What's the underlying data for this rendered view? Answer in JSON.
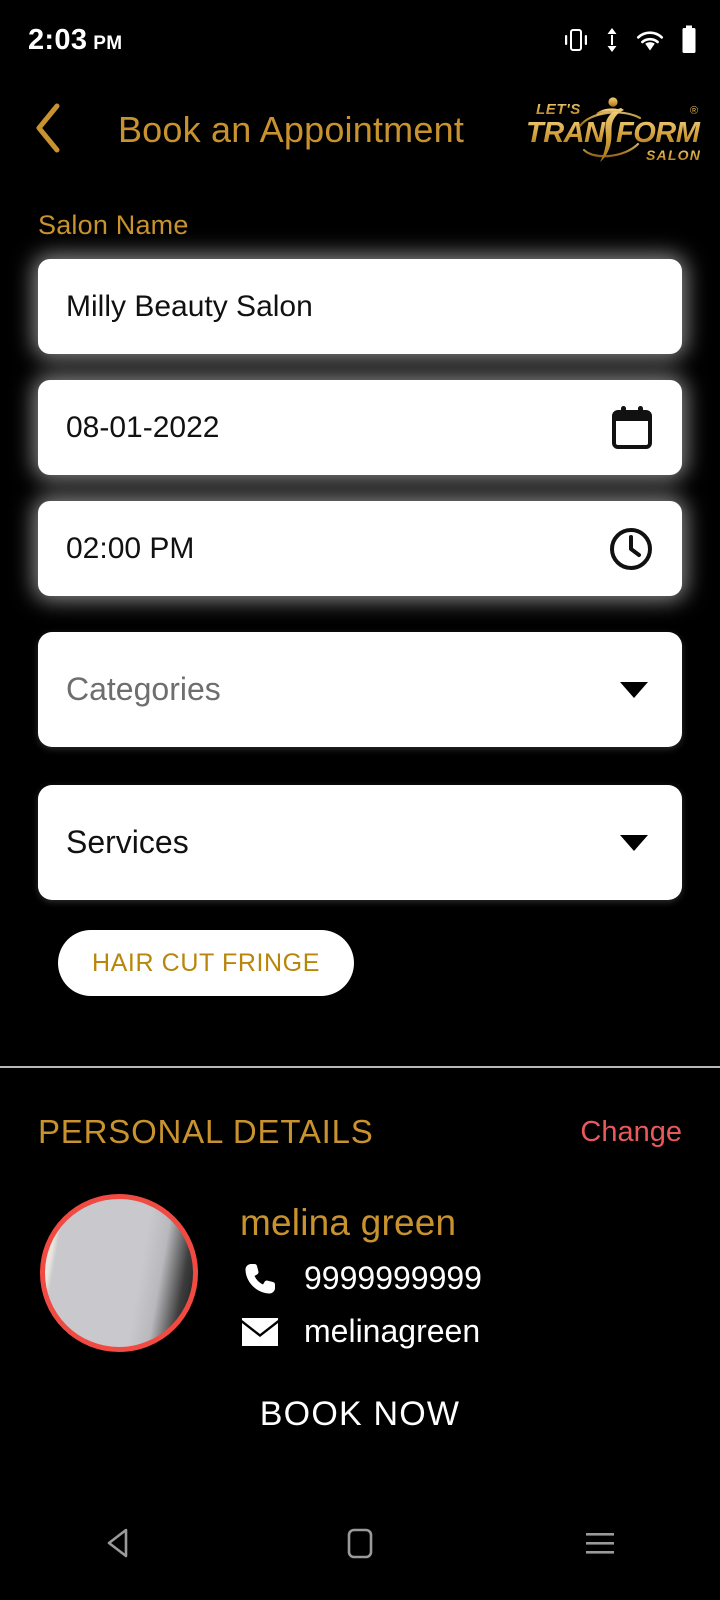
{
  "status_bar": {
    "time": "2:03",
    "meridiem": "PM",
    "icons": [
      "vibrate-icon",
      "data-transfer-icon",
      "wifi-icon",
      "battery-icon"
    ]
  },
  "header": {
    "back_icon": "chevron-left-icon",
    "title": "Book an Appointment",
    "logo": {
      "top_text": "LET'S",
      "main_text_left": "TRAN",
      "main_text_right": "FORM",
      "bottom_text": "SALON",
      "registered_mark": "®"
    }
  },
  "form": {
    "salon_name_label": "Salon Name",
    "salon_name_value": "Milly Beauty Salon",
    "date_value": "08-01-2022",
    "date_icon": "calendar-icon",
    "time_value": "02:00 PM",
    "time_icon": "clock-icon",
    "categories_placeholder": "Categories",
    "categories_caret": "chevron-down-icon",
    "services_value": "Services",
    "services_caret": "chevron-down-icon",
    "selected_services": [
      "HAIR CUT FRINGE"
    ]
  },
  "personal_details": {
    "title": "PERSONAL DETAILS",
    "change_label": "Change",
    "avatar": "user-avatar",
    "name": "melina green",
    "phone_icon": "phone-icon",
    "phone": "9999999999",
    "email_icon": "envelope-icon",
    "email": "melinagreen"
  },
  "cta": {
    "book_now_label": "BOOK NOW"
  },
  "nav_bar": {
    "back": "nav-back-icon",
    "home": "nav-home-icon",
    "recents": "nav-recents-icon"
  },
  "colors": {
    "gold": "#C8922E",
    "gold_light": "#E9C66E",
    "gold_dark": "#BE8620",
    "accent_red": "#E8585C",
    "avatar_ring": "#F04A42",
    "background": "#000000",
    "field_bg": "#FFFFFF",
    "placeholder": "#6E6E6E"
  }
}
